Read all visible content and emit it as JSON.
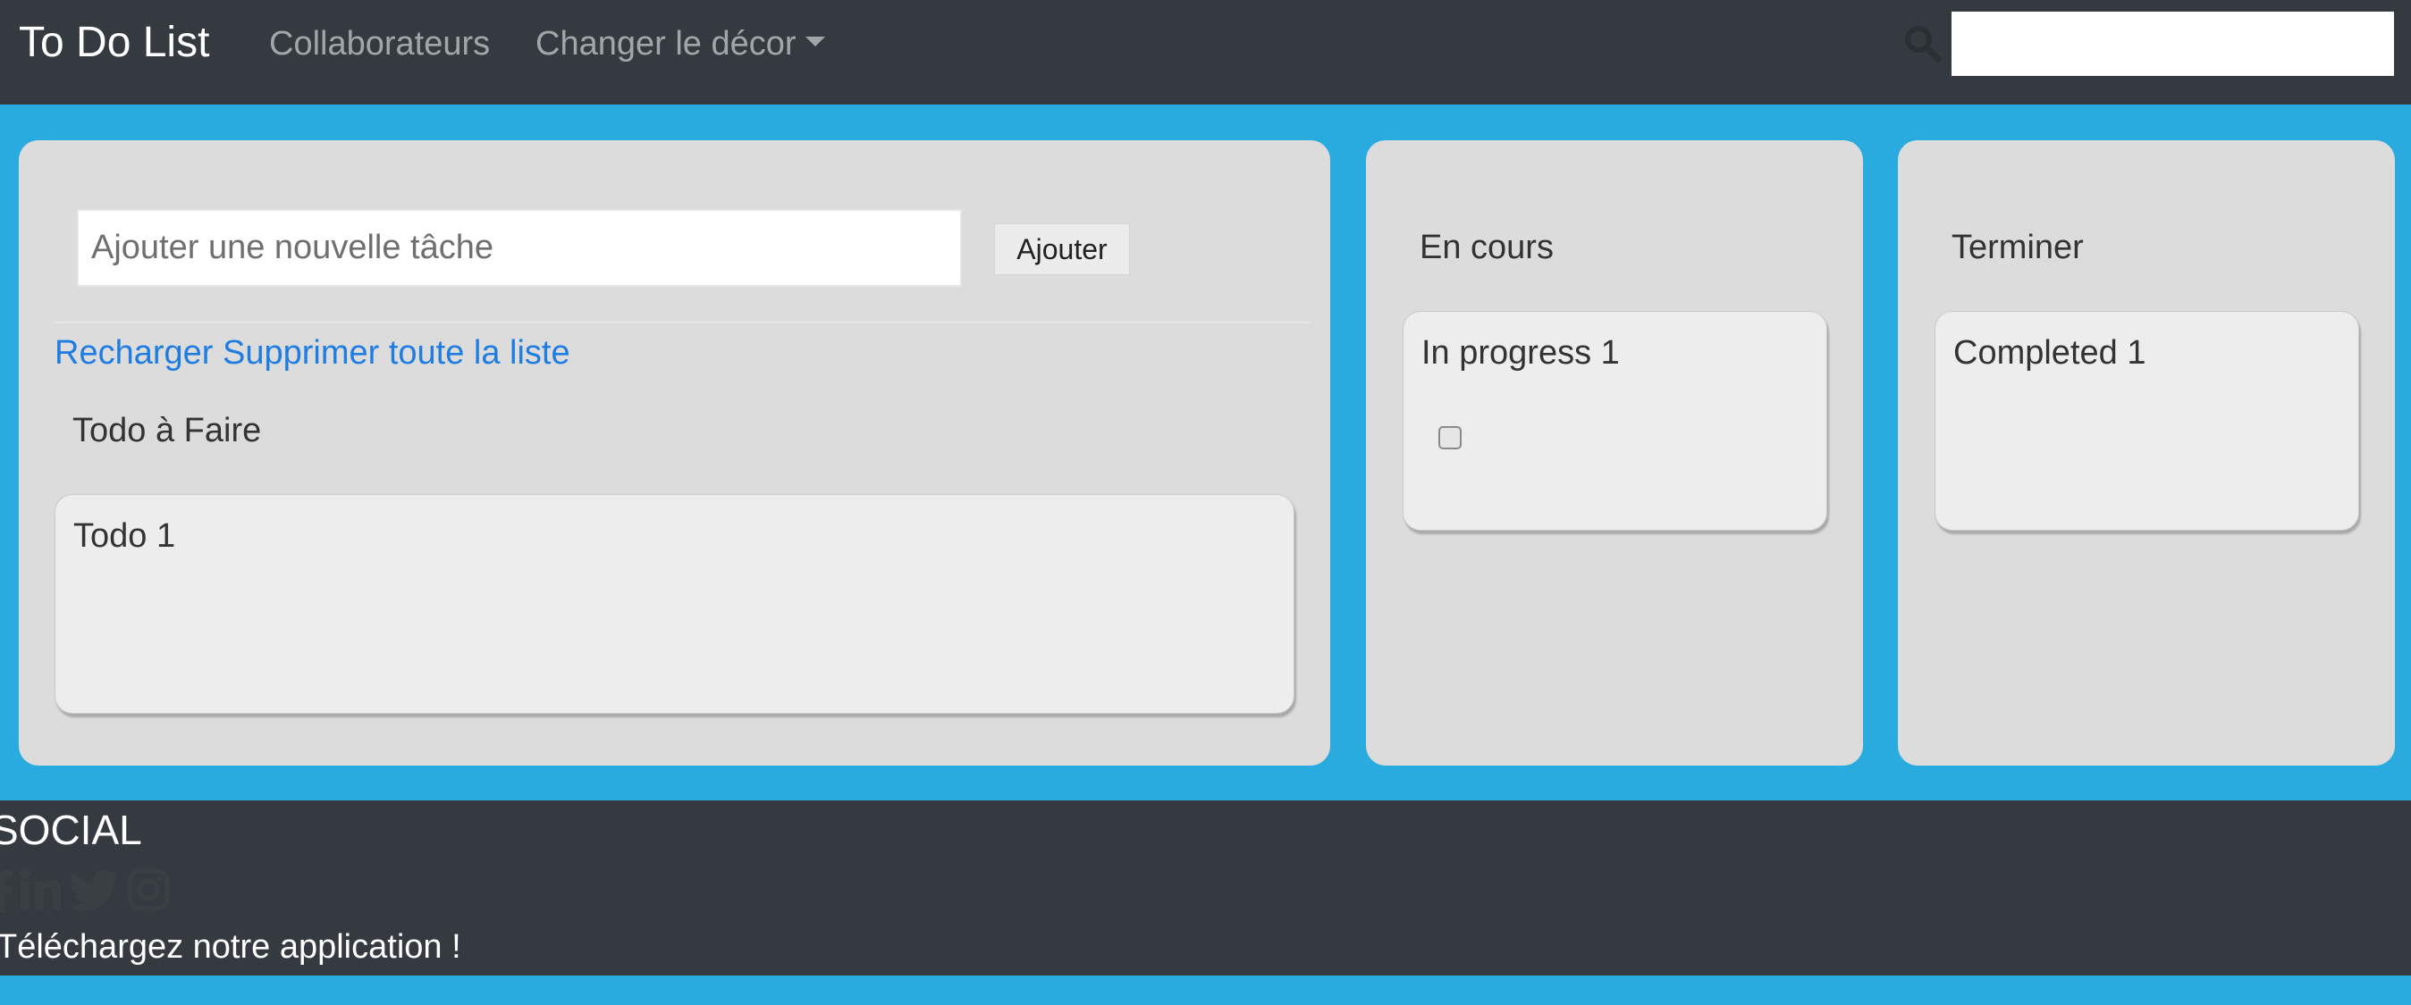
{
  "navbar": {
    "brand": "To Do List",
    "links": [
      "Collaborateurs",
      "Changer le décor"
    ],
    "search_placeholder": ""
  },
  "todo": {
    "input_placeholder": "Ajouter une nouvelle tâche",
    "add_label": "Ajouter",
    "reload_label": "Recharger",
    "delete_all_label": "Supprimer toute la liste",
    "title": "Todo à Faire",
    "cards": [
      "Todo 1"
    ]
  },
  "in_progress": {
    "title": "En cours",
    "cards": [
      "In progress 1"
    ]
  },
  "done": {
    "title": "Terminer",
    "cards": [
      "Completed 1"
    ]
  },
  "footer": {
    "social_title": "SOCIAL",
    "social_icons": [
      "facebook-icon",
      "linkedin-icon",
      "twitter-icon",
      "instagram-icon"
    ],
    "app_text": "Téléchargez notre application !"
  },
  "colors": {
    "background": "#29abe0",
    "navbar": "#343a40",
    "panel": "#dcdcdc",
    "card": "#ededed",
    "link": "#1f7ce0"
  }
}
